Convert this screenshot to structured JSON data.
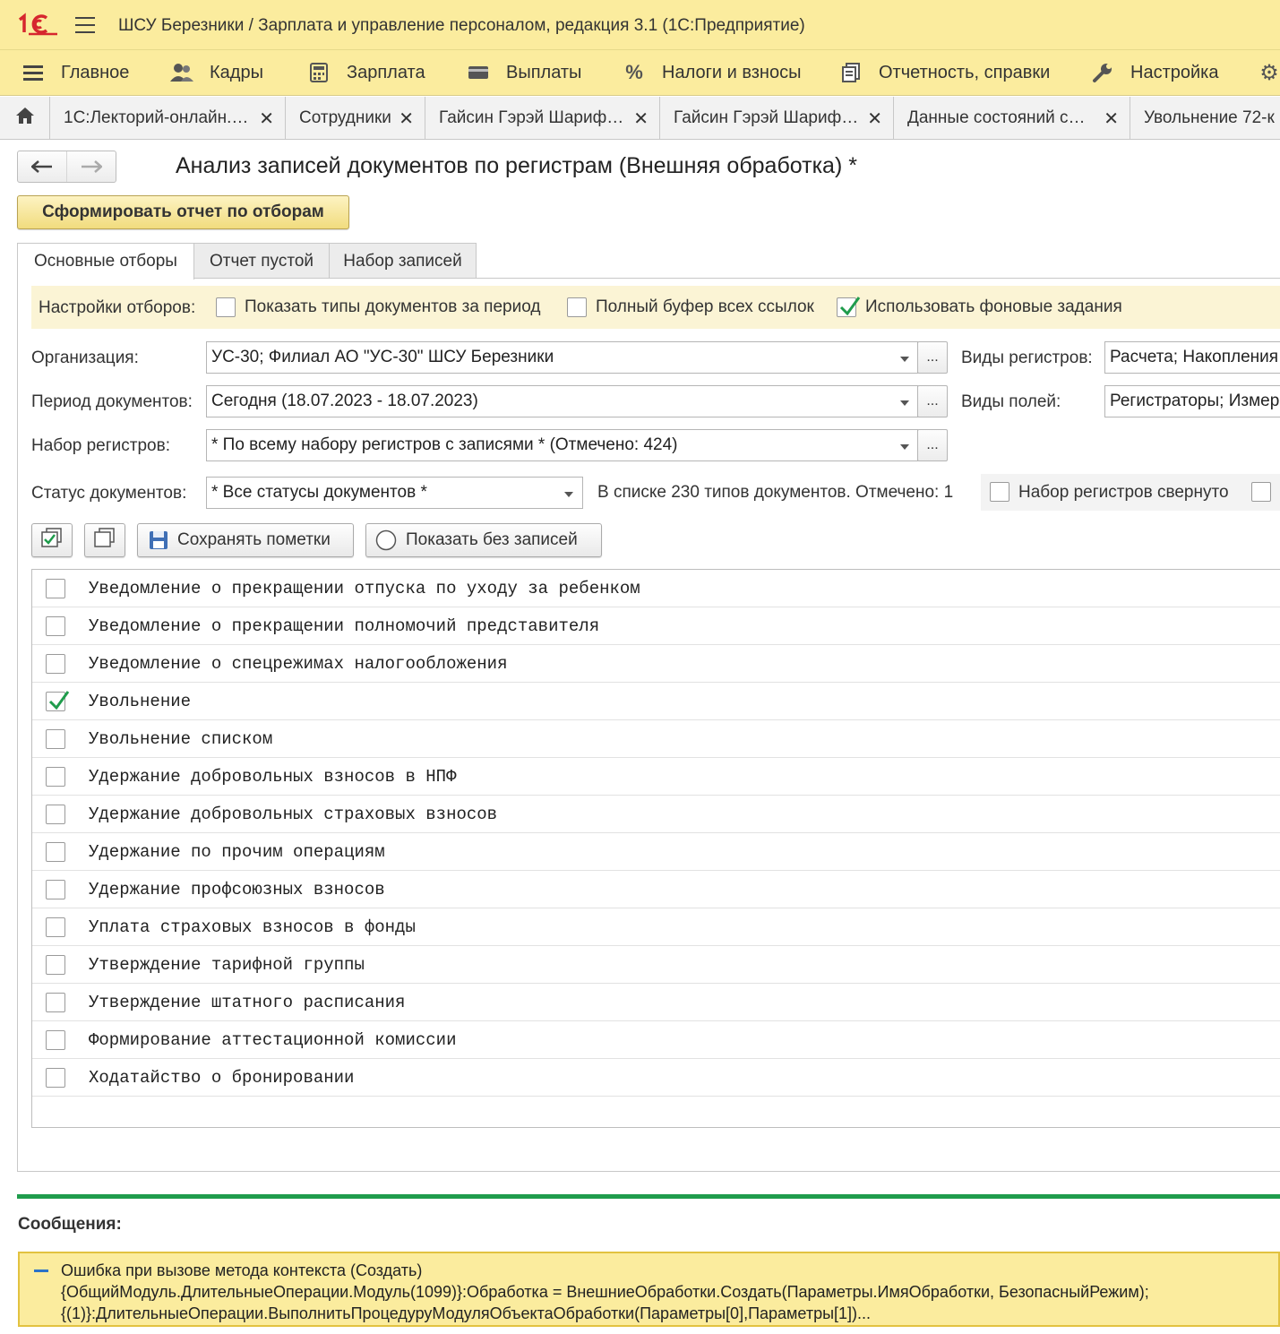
{
  "app": {
    "title": "ШСУ Березники / Зарплата и управление персоналом, редакция 3.1  (1С:Предприятие)",
    "logo_text": "1С"
  },
  "main_menu": [
    {
      "label": "Главное",
      "icon": "hamburger-icon"
    },
    {
      "label": "Кадры",
      "icon": "people-icon"
    },
    {
      "label": "Зарплата",
      "icon": "calculator-icon"
    },
    {
      "label": "Выплаты",
      "icon": "card-icon"
    },
    {
      "label": "Налоги и взносы",
      "icon": "percent-icon"
    },
    {
      "label": "Отчетность, справки",
      "icon": "reports-icon"
    },
    {
      "label": "Настройка",
      "icon": "wrench-icon"
    }
  ],
  "open_tabs": [
    {
      "label": "1С:Лекторий-онлайн.…",
      "closable": true
    },
    {
      "label": "Сотрудники",
      "closable": true
    },
    {
      "label": "Гайсин Гэрэй Шариф…",
      "closable": true
    },
    {
      "label": "Гайсин Гэрэй Шариф…",
      "closable": true
    },
    {
      "label": "Данные состояний с…",
      "closable": true
    },
    {
      "label": "Увольнение 72-к",
      "closable": false
    }
  ],
  "form": {
    "title": "Анализ записей документов по регистрам (Внешняя обработка) *",
    "generate_button": "Сформировать отчет по отборам"
  },
  "page_tabs": [
    {
      "label": "Основные отборы",
      "active": true
    },
    {
      "label": "Отчет пустой",
      "active": false
    },
    {
      "label": "Набор записей",
      "active": false
    }
  ],
  "settings": {
    "label": "Настройки отборов:",
    "options": [
      {
        "label": "Показать типы документов за период",
        "checked": false
      },
      {
        "label": "Полный буфер всех ссылок",
        "checked": false
      },
      {
        "label": "Использовать фоновые задания",
        "checked": true
      }
    ]
  },
  "fields": {
    "organization": {
      "label": "Организация:",
      "value": "УС-30; Филиал АО \"УС-30\" ШСУ Березники"
    },
    "period": {
      "label": "Период документов:",
      "value": "Сегодня (18.07.2023 - 18.07.2023)"
    },
    "register_set": {
      "label": "Набор регистров:",
      "value": "* По всему набору регистров с записями * (Отмечено: 424)"
    },
    "status": {
      "label": "Статус документов:",
      "value": "* Все статусы документов *"
    },
    "register_kinds": {
      "label": "Виды регистров:",
      "value": "Расчета; Накопления"
    },
    "field_kinds": {
      "label": "Виды полей:",
      "value": "Регистраторы; Измер"
    },
    "ellipsis": "..."
  },
  "list_info": {
    "count_text": "В списке 230 типов документов. Отмечено: 1",
    "collapsed_label": "Набор регистров свернуто",
    "collapsed_checked": false
  },
  "toolbar": {
    "save_marks": "Сохранять пометки",
    "show_without": "Показать без записей"
  },
  "document_types": [
    {
      "name": "Уведомление о прекращении отпуска по уходу за ребенком",
      "checked": false
    },
    {
      "name": "Уведомление о прекращении полномочий представителя",
      "checked": false
    },
    {
      "name": "Уведомление о спецрежимах налогообложения",
      "checked": false
    },
    {
      "name": "Увольнение",
      "checked": true
    },
    {
      "name": "Увольнение списком",
      "checked": false
    },
    {
      "name": "Удержание добровольных взносов в НПФ",
      "checked": false
    },
    {
      "name": "Удержание добровольных страховых взносов",
      "checked": false
    },
    {
      "name": "Удержание по прочим операциям",
      "checked": false
    },
    {
      "name": "Удержание профсоюзных взносов",
      "checked": false
    },
    {
      "name": "Уплата страховых взносов в фонды",
      "checked": false
    },
    {
      "name": "Утверждение тарифной группы",
      "checked": false
    },
    {
      "name": "Утверждение штатного расписания",
      "checked": false
    },
    {
      "name": "Формирование аттестационной комиссии",
      "checked": false
    },
    {
      "name": "Ходатайство о бронировании",
      "checked": false
    }
  ],
  "messages": {
    "title": "Сообщения:",
    "lines": [
      "Ошибка при вызове метода контекста (Создать)",
      "{ОбщийМодуль.ДлительныеОперации.Модуль(1099)}:Обработка = ВнешниеОбработки.Создать(Параметры.ИмяОбработки, БезопасныйРежим);",
      "{(1)}:ДлительныеОперации.ВыполнитьПроцедуруМодуляОбъектаОбработки(Параметры[0],Параметры[1])..."
    ]
  },
  "colors": {
    "header_bg": "#fbec9e",
    "brand_red": "#d6262e",
    "check_green": "#1f9c4c",
    "message_border": "#e2c240"
  }
}
